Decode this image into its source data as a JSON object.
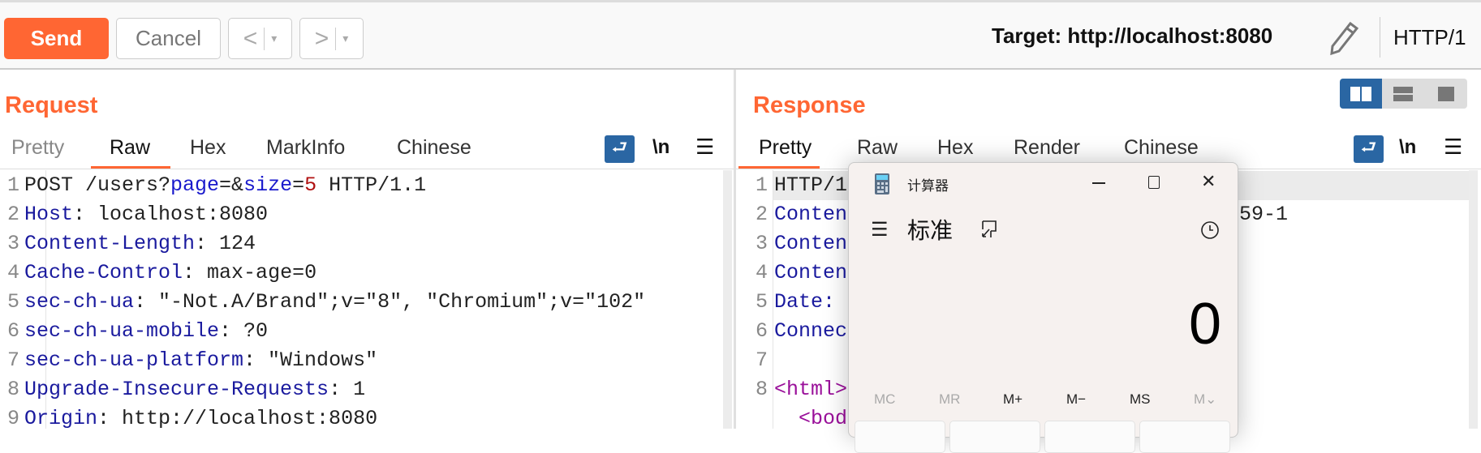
{
  "toolbar": {
    "send": "Send",
    "cancel": "Cancel",
    "back": "<",
    "forward": ">",
    "dropdown": "▾",
    "target": "Target: http://localhost:8080",
    "http_version": "HTTP/1"
  },
  "request": {
    "title": "Request",
    "tabs": [
      "Pretty",
      "Raw",
      "Hex",
      "MarkInfo",
      "Chinese"
    ],
    "active_tab": "Raw",
    "newline_label": "\\n",
    "menu_label": "☰",
    "lines": [
      {
        "n": "1",
        "parts": [
          "POST /users?",
          "page",
          "=&",
          "size",
          "=",
          "5",
          " HTTP/1.1"
        ]
      },
      {
        "n": "2",
        "key": "Host",
        "val": ": localhost:8080"
      },
      {
        "n": "3",
        "key": "Content-Length",
        "val": ": 124"
      },
      {
        "n": "4",
        "key": "Cache-Control",
        "val": ": max-age=0"
      },
      {
        "n": "5",
        "key": "sec-ch-ua",
        "val": ": \"-Not.A/Brand\";v=\"8\", \"Chromium\";v=\"102\""
      },
      {
        "n": "6",
        "key": "sec-ch-ua-mobile",
        "val": ": ?0"
      },
      {
        "n": "7",
        "key": "sec-ch-ua-platform",
        "val": ": \"Windows\""
      },
      {
        "n": "8",
        "key": "Upgrade-Insecure-Requests",
        "val": ": 1"
      },
      {
        "n": "9",
        "key": "Origin",
        "val": ": http://localhost:8080"
      }
    ]
  },
  "response": {
    "title": "Response",
    "tabs": [
      "Pretty",
      "Raw",
      "Hex",
      "Render",
      "Chinese"
    ],
    "active_tab": "Pretty",
    "newline_label": "\\n",
    "menu_label": "☰",
    "lines": [
      {
        "n": "1",
        "text": "HTTP/1"
      },
      {
        "n": "2",
        "text": "Conten",
        "tail": "59-1"
      },
      {
        "n": "3",
        "text": "Conten"
      },
      {
        "n": "4",
        "text": "Conten"
      },
      {
        "n": "5",
        "text": "Date:"
      },
      {
        "n": "6",
        "text": "Connec"
      },
      {
        "n": "7",
        "text": ""
      },
      {
        "n": "8",
        "text": "<html>"
      },
      {
        "n": "",
        "text": "  <bod"
      }
    ]
  },
  "calculator": {
    "title": "计算器",
    "mode": "标准",
    "display": "0",
    "memory": [
      "MC",
      "MR",
      "M+",
      "M−",
      "MS",
      "M⌄"
    ]
  },
  "colors": {
    "accent": "#ff6633",
    "blue": "#2a66a3"
  }
}
